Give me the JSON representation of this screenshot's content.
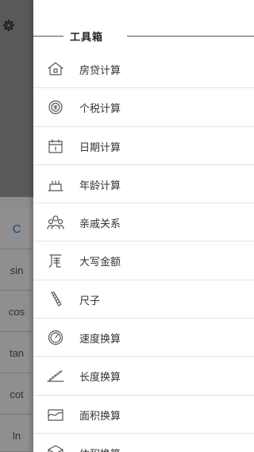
{
  "drawer": {
    "title": "工具箱",
    "items": [
      {
        "label": "房贷计算",
        "icon": "house-icon"
      },
      {
        "label": "个税计算",
        "icon": "tax-badge-icon"
      },
      {
        "label": "日期计算",
        "icon": "calendar-icon"
      },
      {
        "label": "年龄计算",
        "icon": "cake-icon"
      },
      {
        "label": "亲戚关系",
        "icon": "family-icon"
      },
      {
        "label": "大写金额",
        "icon": "amount-icon"
      },
      {
        "label": "尺子",
        "icon": "ruler-icon"
      },
      {
        "label": "速度换算",
        "icon": "speedometer-icon"
      },
      {
        "label": "长度换算",
        "icon": "tape-icon"
      },
      {
        "label": "面积换算",
        "icon": "area-icon"
      },
      {
        "label": "体积换算",
        "icon": "cube-icon"
      }
    ]
  },
  "background": {
    "settings_icon": "gear-icon",
    "keys": [
      "C",
      "sin",
      "cos",
      "tan",
      "cot",
      "ln"
    ]
  },
  "colors": {
    "accent": "#2b7fd3",
    "overlay": "#000000"
  }
}
